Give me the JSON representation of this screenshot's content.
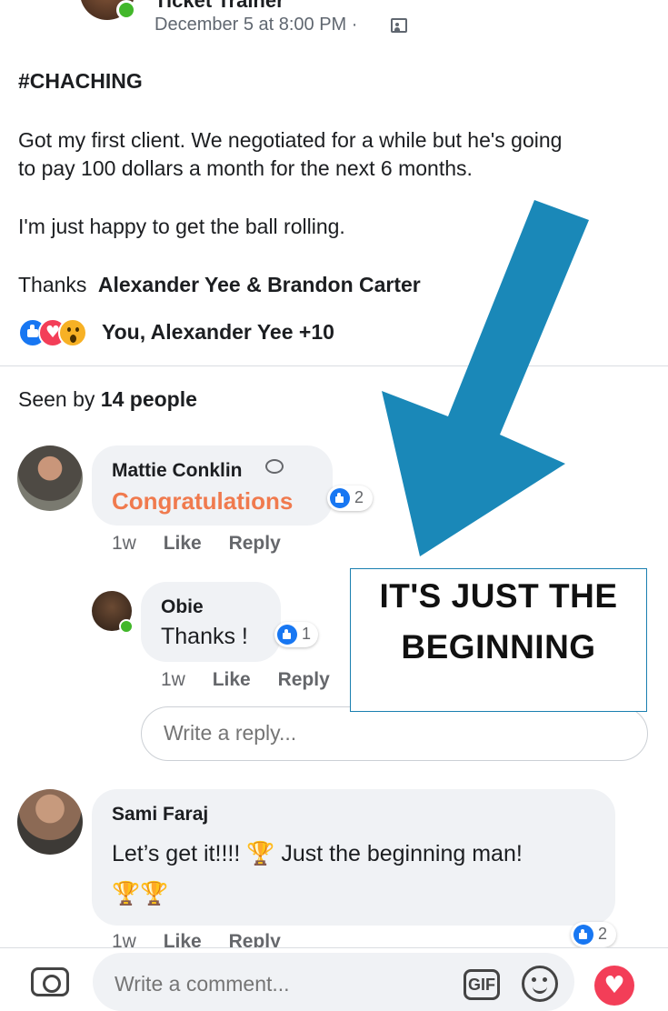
{
  "post": {
    "page_name": "Ticket Trainer",
    "date": "December 5 at 8:00 PM ·",
    "headline": "#CHACHING",
    "paragraph1_line1": "Got my first client. We negotiated for a while but he's going",
    "paragraph1_line2": "to pay 100 dollars a month for the next 6 months.",
    "paragraph2": "I'm just happy to get the ball rolling.",
    "thanks_prefix": "Thanks",
    "thanks_names": "Alexander Yee & Brandon Carter",
    "reactions_text": "You, Alexander Yee +10",
    "seen_prefix": "Seen by",
    "seen_count": "14 people"
  },
  "comments": [
    {
      "name": "Mattie Conklin",
      "text": "Congratulations",
      "likes": "2",
      "time": "1w",
      "like_label": "Like",
      "reply_label": "Reply"
    },
    {
      "name": "Obie",
      "text": "Thanks !",
      "likes": "1",
      "time": "1w",
      "like_label": "Like",
      "reply_label": "Reply"
    },
    {
      "name": "Sami Faraj",
      "text": "Let’s get it!!!!",
      "text_after": "Just the beginning man!",
      "likes": "2",
      "time": "1w",
      "like_label": "Like",
      "reply_label": "Reply"
    }
  ],
  "reply_box": {
    "placeholder": "Write a reply..."
  },
  "banner": {
    "line1": "IT'S JUST THE",
    "line2": "BEGINNING"
  },
  "composer": {
    "placeholder": "Write a comment...",
    "gif_label": "GIF"
  },
  "icons": [
    "privacy-icon",
    "like-reaction-icon",
    "love-reaction-icon",
    "wow-reaction-icon",
    "messenger-icon",
    "trophy-icon",
    "camera-icon",
    "gif-icon",
    "emoji-icon",
    "heart-icon",
    "arrow-annotation"
  ],
  "colors": {
    "accent": "#1877f2",
    "congrats": "#f07a4e",
    "arrow": "#1a88b8",
    "love": "#f33e58"
  }
}
